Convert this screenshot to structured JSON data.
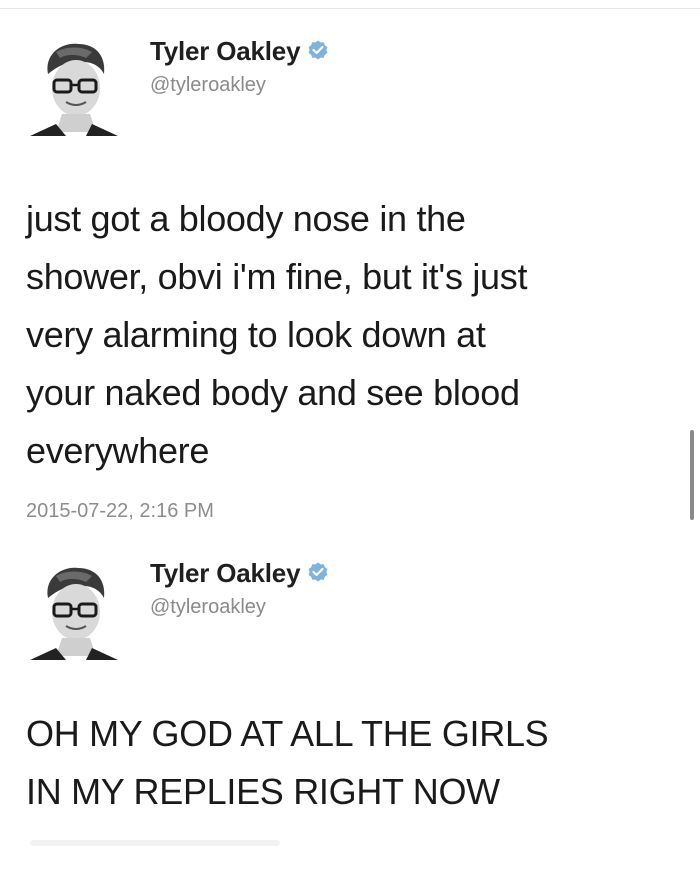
{
  "tweets": [
    {
      "user": {
        "name": "Tyler Oakley",
        "handle": "@tyleroakley",
        "verified": true
      },
      "text_lines": [
        "just got a bloody nose in the",
        "shower, obvi i'm fine, but it's just",
        "very alarming to look down at",
        "your naked body and see blood",
        "everywhere"
      ],
      "timestamp": "2015-07-22, 2:16 PM"
    },
    {
      "user": {
        "name": "Tyler Oakley",
        "handle": "@tyleroakley",
        "verified": true
      },
      "text_lines": [
        "OH MY GOD AT ALL THE GIRLS",
        "IN MY REPLIES RIGHT NOW"
      ]
    }
  ],
  "colors": {
    "verified_badge": "#7fb3dc",
    "handle": "#8a8a8a",
    "timestamp": "#8d8d8d"
  },
  "icons": {
    "verified": "verified-badge-icon",
    "avatar": "profile-photo"
  }
}
